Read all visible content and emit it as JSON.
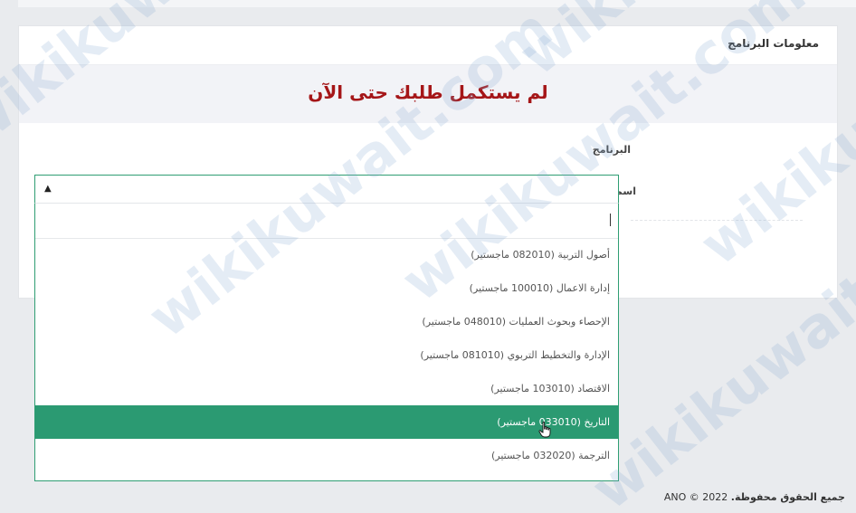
{
  "card": {
    "title": "معلومات البرنامج"
  },
  "banner": {
    "message": "لم يستكمل طلبك حتى الآن"
  },
  "form": {
    "program_label": "البرنامج",
    "program_name_label": "اسم البرنامج"
  },
  "dropdown": {
    "search_value": "",
    "options": [
      "أصول التربية (082010 ماجستير)",
      "إدارة الاعمال (100010 ماجستير)",
      "الإحصاء وبحوث العمليات (048010 ماجستير)",
      "الإدارة والتخطيط التربوي (081010 ماجستير)",
      "الاقتصاد (103010 ماجستير)",
      "التاريخ (033010 ماجستير)",
      "الترجمة (032020 ماجستير)"
    ],
    "highlighted_index": 5
  },
  "footer": {
    "rights": "جميع الحقوق محفوظة.",
    "copyright": "2022 © ANO"
  },
  "watermark": {
    "text": "wikikuwait.com"
  },
  "colors": {
    "accent_green": "#2b9a72",
    "banner_red": "#a51618"
  },
  "icons": {
    "caret": "caret-up-icon",
    "pointer": "hand-pointer-icon"
  }
}
